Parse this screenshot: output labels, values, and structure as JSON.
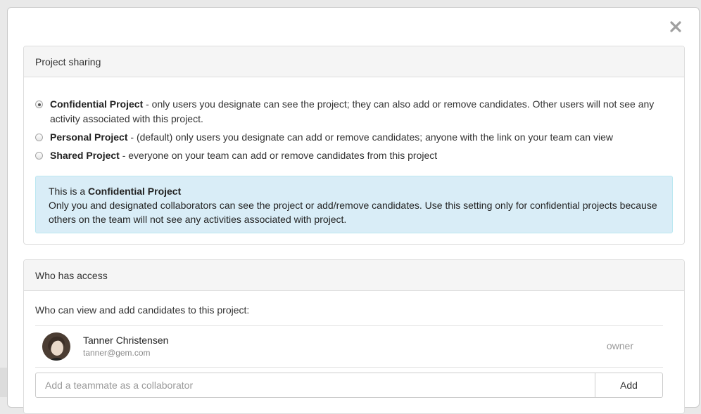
{
  "modal": {
    "close_icon": "close-icon",
    "close_color": "#a0a0a0"
  },
  "sharing": {
    "heading": "Project sharing",
    "options": [
      {
        "title": "Confidential Project",
        "description": " - only users you designate can see the project; they can also add or remove candidates. Other users will not see any activity associated with this project.",
        "checked": true
      },
      {
        "title": "Personal Project",
        "description": " - (default) only users you designate can add or remove candidates; anyone with the link on your team can view",
        "checked": false
      },
      {
        "title": "Shared Project",
        "description": " - everyone on your team can add or remove candidates from this project",
        "checked": false
      }
    ],
    "info": {
      "prefix": "This is a ",
      "title": "Confidential Project",
      "body": "Only you and designated collaborators can see the project or add/remove candidates. Use this setting only for confidential projects because others on the team will not see any activities associated with project.",
      "background": "#d9edf7",
      "border": "#bce8f1",
      "text_color": "#31708f"
    }
  },
  "access": {
    "heading": "Who has access",
    "label": "Who can view and add candidates to this project:",
    "users": [
      {
        "name": "Tanner Christensen",
        "email": "tanner@gem.com",
        "role": "owner"
      }
    ],
    "add_input_placeholder": "Add a teammate as a collaborator",
    "add_button_label": "Add"
  }
}
